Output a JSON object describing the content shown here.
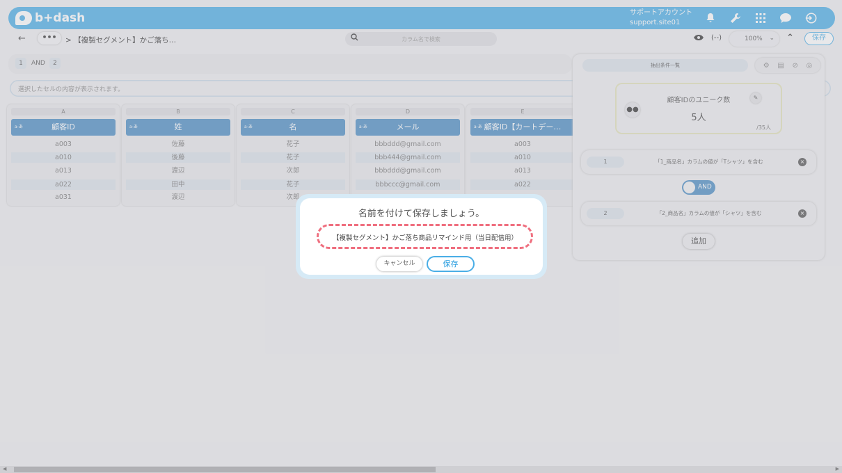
{
  "header": {
    "logo": "b+dash",
    "account_line1": "サポートアカウント",
    "account_line2": "support.site01"
  },
  "subbar": {
    "breadcrumb": "> 【複製セグメント】かご落ち…",
    "search_placeholder": "カラム名で検索",
    "zoom": "100%",
    "save_label": "保存"
  },
  "conditions_bar": {
    "first": "1",
    "op": "AND",
    "second": "2"
  },
  "cell_display_text": "選択したセルの内容が表示されます。",
  "grid": {
    "columns": [
      {
        "letter": "A",
        "header": "顧客ID",
        "cells": [
          "a003",
          "a010",
          "a013",
          "a022",
          "a031"
        ]
      },
      {
        "letter": "B",
        "header": "姓",
        "cells": [
          "佐藤",
          "後藤",
          "渡辺",
          "田中",
          "渡辺"
        ]
      },
      {
        "letter": "C",
        "header": "名",
        "cells": [
          "花子",
          "花子",
          "次郎",
          "花子",
          "次郎"
        ]
      },
      {
        "letter": "D",
        "header": "メール",
        "cells": [
          "bbbddd@gmail.com",
          "bbb444@gmail.com",
          "bbbddd@gmail.com",
          "bbbccc@gmail.com",
          ""
        ]
      },
      {
        "letter": "E",
        "header": "顧客ID【カートデー…",
        "cells": [
          "a003",
          "a010",
          "a013",
          "a022",
          ""
        ]
      }
    ],
    "type_tag": "a-あ"
  },
  "panel": {
    "title": "抽出条件一覧",
    "count_label": "顧客IDのユニーク数",
    "count_value": "5人",
    "count_total": "/35人",
    "conditions": [
      {
        "index": "1",
        "text": "「1_商品名」カラムの値が「Tシャツ」を含む"
      },
      {
        "index": "2",
        "text": "「2_商品名」カラムの値が「シャツ」を含む"
      }
    ],
    "and_label": "AND",
    "add_label": "追加"
  },
  "modal": {
    "title": "名前を付けて保存しましょう。",
    "name_value": "【複製セグメント】かご落ち商品リマインド用（当日配信用）",
    "cancel_label": "キャンセル",
    "save_label": "保存"
  },
  "colors": {
    "brand": "#4aaee6",
    "column_header": "#4a8cc4",
    "highlight": "#ef6f7f"
  }
}
